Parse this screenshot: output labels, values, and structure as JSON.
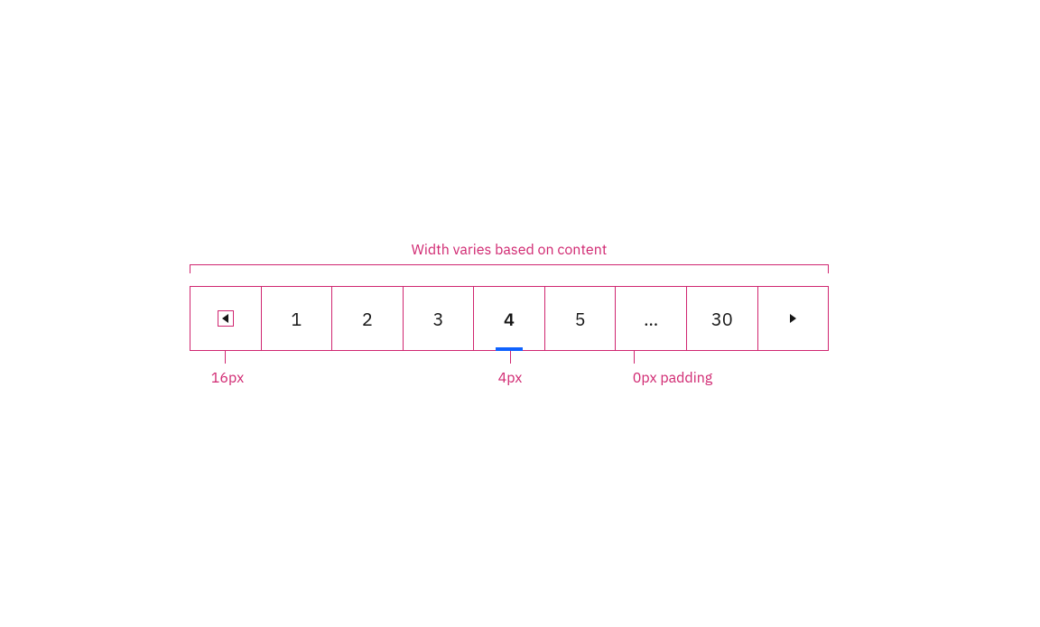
{
  "annotations": {
    "top_label": "Width varies based on content",
    "icon_size": "16px",
    "underline_height": "4px",
    "padding": "0px padding"
  },
  "pagination": {
    "pages": [
      "1",
      "2",
      "3",
      "4",
      "5",
      "…",
      "30"
    ],
    "active_index": 3,
    "prev_icon": "caret-left",
    "next_icon": "caret-right"
  },
  "colors": {
    "spec": "#d02670",
    "accent": "#0f62fe",
    "text": "#161616"
  }
}
